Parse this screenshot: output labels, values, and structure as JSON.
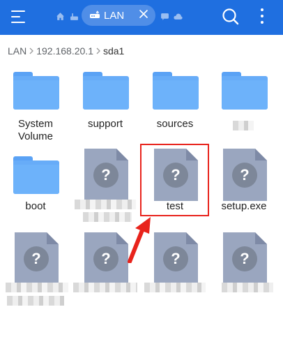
{
  "toolbar": {
    "tab_label": "LAN"
  },
  "breadcrumb": {
    "root": "LAN",
    "host": "192.168.20.1",
    "folder": "sda1"
  },
  "items": [
    {
      "name": "System\nVolume",
      "type": "folder"
    },
    {
      "name": "support",
      "type": "folder"
    },
    {
      "name": "sources",
      "type": "folder"
    },
    {
      "name": "",
      "type": "folder"
    },
    {
      "name": "boot",
      "type": "folder"
    },
    {
      "name": "",
      "type": "file"
    },
    {
      "name": "test",
      "type": "file"
    },
    {
      "name": "setup.exe",
      "type": "file"
    },
    {
      "name": "",
      "type": "file"
    },
    {
      "name": "",
      "type": "file"
    },
    {
      "name": "",
      "type": "file"
    },
    {
      "name": "",
      "type": "file"
    }
  ],
  "colors": {
    "accent": "#1f6fe0",
    "folder": "#67acf8",
    "file": "#9aa6bf",
    "highlight": "#e8231c"
  }
}
